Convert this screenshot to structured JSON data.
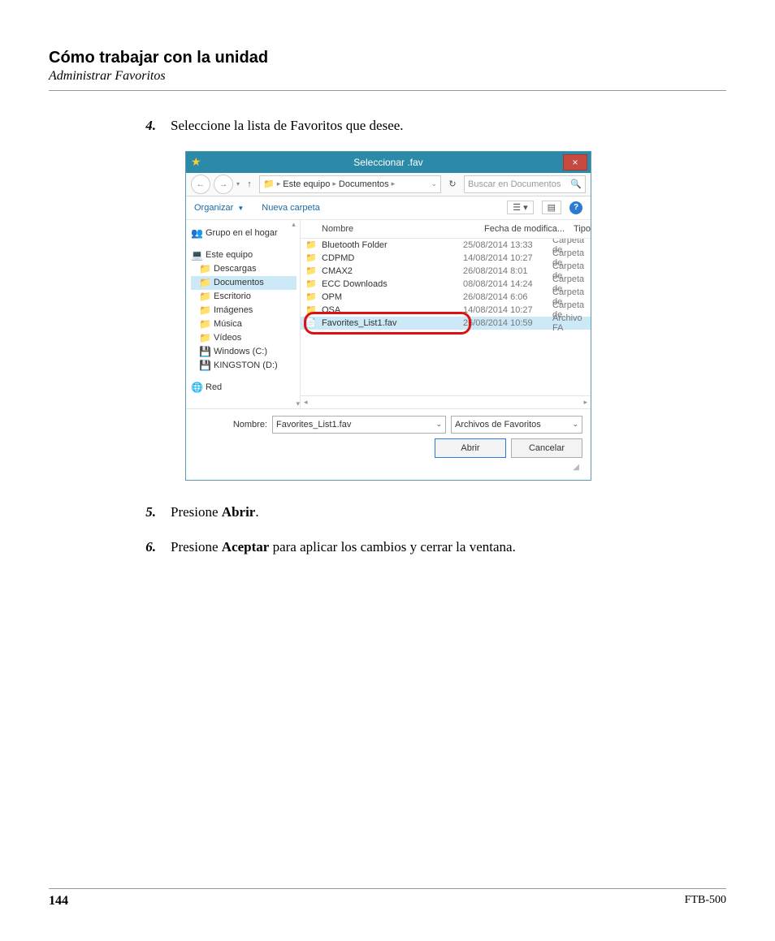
{
  "doc": {
    "section_title": "Cómo trabajar con la unidad",
    "section_sub": "Administrar Favoritos",
    "page_number": "144",
    "product": "FTB-500"
  },
  "steps": {
    "s4_num": "4.",
    "s4_text": "Seleccione la lista de Favoritos que desee.",
    "s5_num": "5.",
    "s5_pre": "Presione ",
    "s5_bold": "Abrir",
    "s5_post": ".",
    "s6_num": "6.",
    "s6_pre": "Presione ",
    "s6_bold": "Aceptar",
    "s6_post": " para aplicar los cambios y cerrar la ventana."
  },
  "dialog": {
    "title": "Seleccionar .fav",
    "close": "×",
    "nav": {
      "back": "←",
      "forward": "→",
      "up": "↑",
      "refresh": "↻",
      "crumb1": "Este equipo",
      "crumb2": "Documentos",
      "search_placeholder": "Buscar en Documentos",
      "search_icon": "🔍"
    },
    "toolbar": {
      "organize": "Organizar ",
      "organize_drop": "▼",
      "new_folder": "Nueva carpeta",
      "view_icon": "☰",
      "view_drop": "▾",
      "pane_icon": "▤",
      "help": "?"
    },
    "tree": {
      "homegroup": "Grupo en el hogar",
      "thispc": "Este equipo",
      "downloads": "Descargas",
      "documents": "Documentos",
      "desktop": "Escritorio",
      "pictures": "Imágenes",
      "music": "Música",
      "videos": "Vídeos",
      "cdrive": "Windows (C:)",
      "ddrive": "KINGSTON (D:)",
      "network": "Red"
    },
    "columns": {
      "name": "Nombre",
      "date": "Fecha de modifica...",
      "type": "Tipo"
    },
    "rows": [
      {
        "icon": "📁",
        "name": "Bluetooth Folder",
        "date": "25/08/2014 13:33",
        "type": "Carpeta de"
      },
      {
        "icon": "📁",
        "name": "CDPMD",
        "date": "14/08/2014 10:27",
        "type": "Carpeta de"
      },
      {
        "icon": "📁",
        "name": "CMAX2",
        "date": "26/08/2014 8:01",
        "type": "Carpeta de"
      },
      {
        "icon": "📁",
        "name": "ECC Downloads",
        "date": "08/08/2014 14:24",
        "type": "Carpeta de"
      },
      {
        "icon": "📁",
        "name": "OPM",
        "date": "26/08/2014 6:06",
        "type": "Carpeta de"
      },
      {
        "icon": "📁",
        "name": "OSA",
        "date": "14/08/2014 10:27",
        "type": "Carpeta de"
      },
      {
        "icon": "📄",
        "name": "Favorites_List1.fav",
        "date": "26/08/2014 10:59",
        "type": "Archivo FA"
      }
    ],
    "footer": {
      "name_label": "Nombre:",
      "name_value": "Favorites_List1.fav",
      "filter": "Archivos de Favoritos",
      "open": "Abrir",
      "cancel": "Cancelar"
    }
  }
}
